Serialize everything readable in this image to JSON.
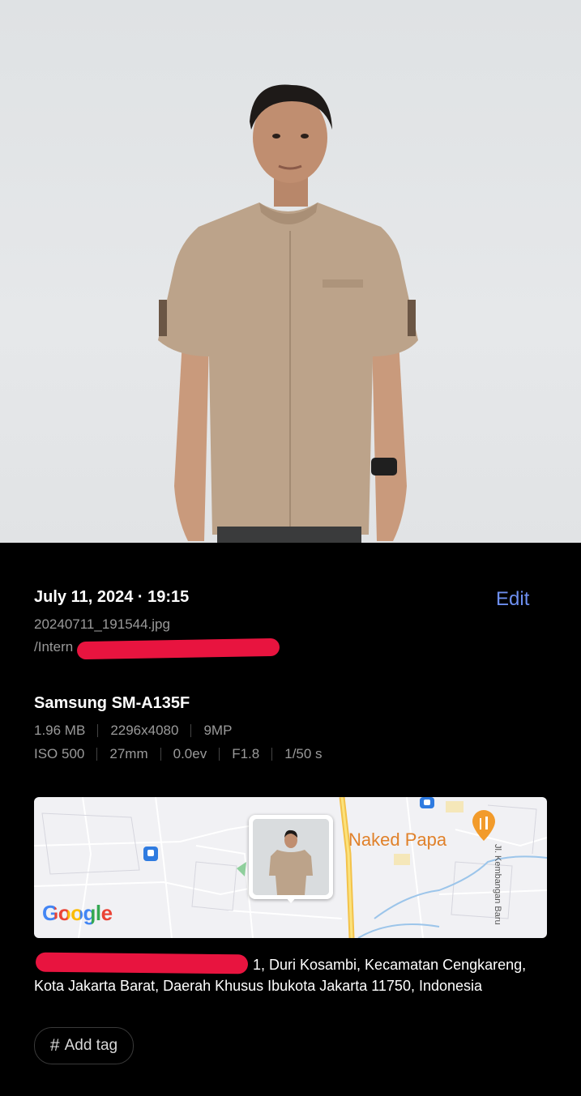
{
  "details": {
    "date": "July 11, 2024 · 19:15",
    "edit_label": "Edit",
    "filename": "20240711_191544.jpg",
    "path": "/Intern"
  },
  "camera": {
    "device": "Samsung SM-A135F",
    "specs_row1": [
      "1.96 MB",
      "2296x4080",
      "9MP"
    ],
    "specs_row2": [
      "ISO 500",
      "27mm",
      "0.0ev",
      "F1.8",
      "1/50 s"
    ]
  },
  "map": {
    "place_label": "Naked Papa",
    "street_label": "Jl. Kembangan Baru",
    "logo_text": "Google",
    "icons": [
      "train-station-icon",
      "restaurant-pin-icon"
    ]
  },
  "location": {
    "address_line1_visible": "1, Duri Kosambi, Kecamatan Cengkareng,",
    "address_line2": "Kota Jakarta Barat, Daerah Khusus Ibukota Jakarta 11750, Indonesia"
  },
  "tag": {
    "icon": "hash-icon",
    "label": "Add tag"
  },
  "colors": {
    "accent": "#6d8ff0",
    "redaction": "#e8143f",
    "background": "#000000",
    "secondary_text": "#9a9a9a"
  }
}
